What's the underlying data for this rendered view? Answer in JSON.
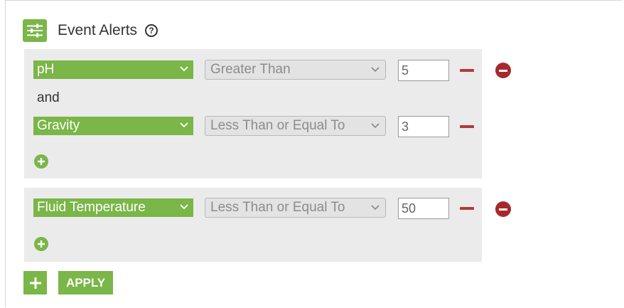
{
  "header": {
    "title": "Event Alerts",
    "help_glyph": "?",
    "icon": "sliders-icon"
  },
  "colors": {
    "accent": "#7ab648",
    "remove": "#a5282c",
    "panel": "#ebebeb"
  },
  "groups": [
    {
      "conditions": [
        {
          "metric": "pH",
          "operator": "Greater Than",
          "value": "5"
        },
        {
          "metric": "Gravity",
          "operator": "Less Than or Equal To",
          "value": "3"
        }
      ],
      "joiner": "and"
    },
    {
      "conditions": [
        {
          "metric": "Fluid Temperature",
          "operator": "Less Than or Equal To",
          "value": "50"
        }
      ]
    }
  ],
  "footer": {
    "apply_label": "APPLY"
  }
}
